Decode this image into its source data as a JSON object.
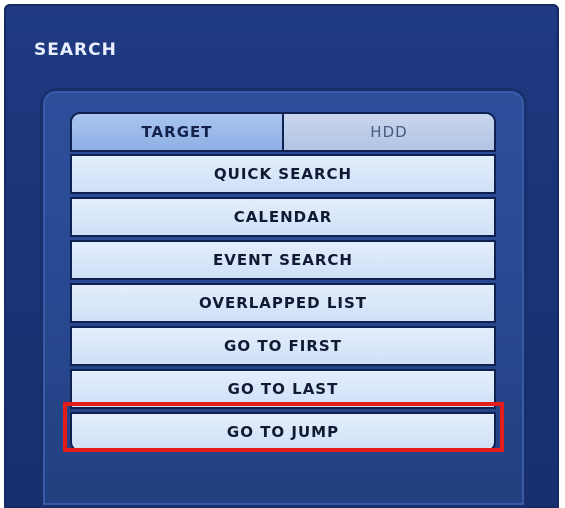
{
  "window": {
    "title": "SEARCH"
  },
  "tabs": [
    {
      "label": "TARGET",
      "selected": true
    },
    {
      "label": "HDD",
      "selected": false
    }
  ],
  "menu": {
    "items": [
      {
        "label": "QUICK SEARCH"
      },
      {
        "label": "CALENDAR"
      },
      {
        "label": "EVENT SEARCH"
      },
      {
        "label": "OVERLAPPED LIST"
      },
      {
        "label": "GO TO FIRST"
      },
      {
        "label": "GO TO LAST"
      },
      {
        "label": "GO TO JUMP",
        "highlighted": true
      }
    ]
  },
  "colors": {
    "window_bg": "#1a3478",
    "panel_bg": "#284891",
    "item_bg": "#d9e7f9",
    "tab_active_bg": "#9ab8ea",
    "highlight": "#e21b1b"
  }
}
